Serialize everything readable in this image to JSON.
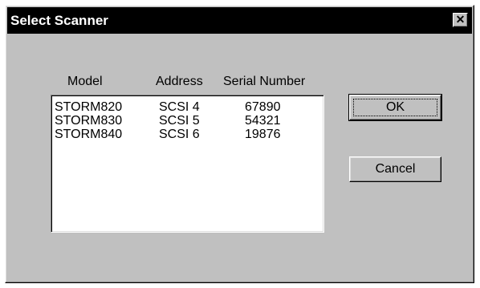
{
  "dialog": {
    "title": "Select Scanner",
    "close_glyph": "✕"
  },
  "columns": {
    "model": "Model",
    "address": "Address",
    "serial": "Serial Number"
  },
  "scanners": [
    {
      "model": "STORM820",
      "address": "SCSI 4",
      "serial": "67890"
    },
    {
      "model": "STORM830",
      "address": "SCSI 5",
      "serial": "54321"
    },
    {
      "model": "STORM840",
      "address": "SCSI 6",
      "serial": "19876"
    }
  ],
  "buttons": {
    "ok": "OK",
    "cancel": "Cancel"
  },
  "colors": {
    "titlebar": "#000000",
    "face": "#c0c0c0",
    "list_bg": "#ffffff"
  }
}
